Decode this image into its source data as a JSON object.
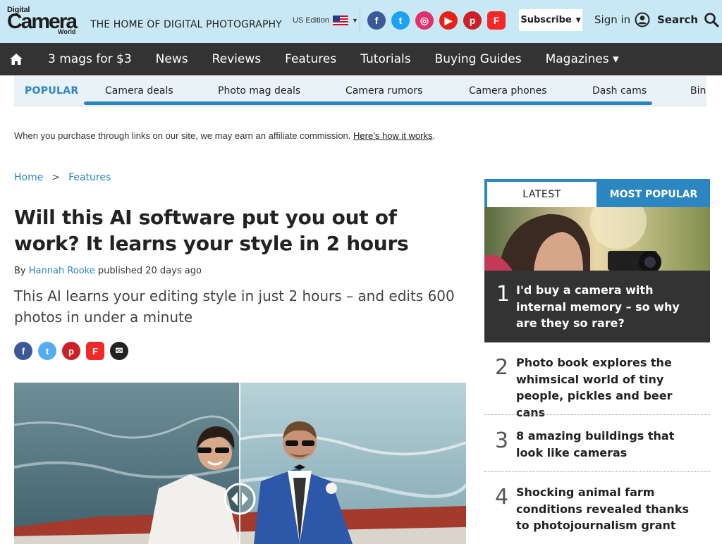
{
  "header": {
    "logo": {
      "line1": "Digital",
      "line2": "Camera",
      "line3": "World"
    },
    "tagline": "THE HOME OF DIGITAL PHOTOGRAPHY",
    "edition": "US Edition",
    "socials": [
      {
        "name": "facebook",
        "glyph": "f",
        "color": "#3b5998"
      },
      {
        "name": "twitter",
        "glyph": "t",
        "color": "#1da1f2"
      },
      {
        "name": "instagram",
        "glyph": "◎",
        "color": "#e1306c"
      },
      {
        "name": "youtube",
        "glyph": "▶",
        "color": "#e62117"
      },
      {
        "name": "pinterest",
        "glyph": "p",
        "color": "#cb2027"
      },
      {
        "name": "flipboard",
        "glyph": "F",
        "color": "#f52828"
      }
    ],
    "subscribe_label": "Subscribe",
    "signin_label": "Sign in",
    "search_label": "Search"
  },
  "nav": {
    "items": [
      "3 mags for $3",
      "News",
      "Reviews",
      "Features",
      "Tutorials",
      "Buying Guides",
      "Magazines ▾"
    ]
  },
  "popular": {
    "label": "POPULAR",
    "items": [
      "Camera deals",
      "Photo mag deals",
      "Camera rumors",
      "Camera phones",
      "Dash cams",
      "Bin"
    ]
  },
  "affiliate": {
    "text": "When you purchase through links on our site, we may earn an affiliate commission.",
    "link": "Here’s how it works",
    "end": "."
  },
  "breadcrumb": {
    "home": "Home",
    "separator": ">",
    "section": "Features"
  },
  "article": {
    "headline": "Will this AI software put you out of work? It learns your style in 2 hours",
    "by": "By",
    "author": "Hannah Rooke",
    "published": "published 20 days ago",
    "strapline": "This AI learns your editing style in just 2 hours – and edits 600 photos in under a minute"
  },
  "share": [
    {
      "name": "facebook",
      "glyph": "f",
      "color": "#3b5998"
    },
    {
      "name": "twitter",
      "glyph": "t",
      "color": "#55acee"
    },
    {
      "name": "pinterest",
      "glyph": "p",
      "color": "#cb2027"
    },
    {
      "name": "flipboard",
      "glyph": "F",
      "color": "#f52828"
    },
    {
      "name": "email",
      "glyph": "✉",
      "color": "#222222"
    }
  ],
  "sidebar": {
    "tab_latest": "LATEST",
    "tab_popular": "MOST POPULAR",
    "items": [
      {
        "num": "1",
        "title": "I'd buy a camera with internal memory – so why are they so rare?"
      },
      {
        "num": "2",
        "title": "Photo book explores the whimsical world of tiny people, pickles and beer cans"
      },
      {
        "num": "3",
        "title": "8 amazing buildings that look like cameras"
      },
      {
        "num": "4",
        "title": "Shocking animal farm conditions revealed thanks to photojournalism grant"
      }
    ]
  }
}
